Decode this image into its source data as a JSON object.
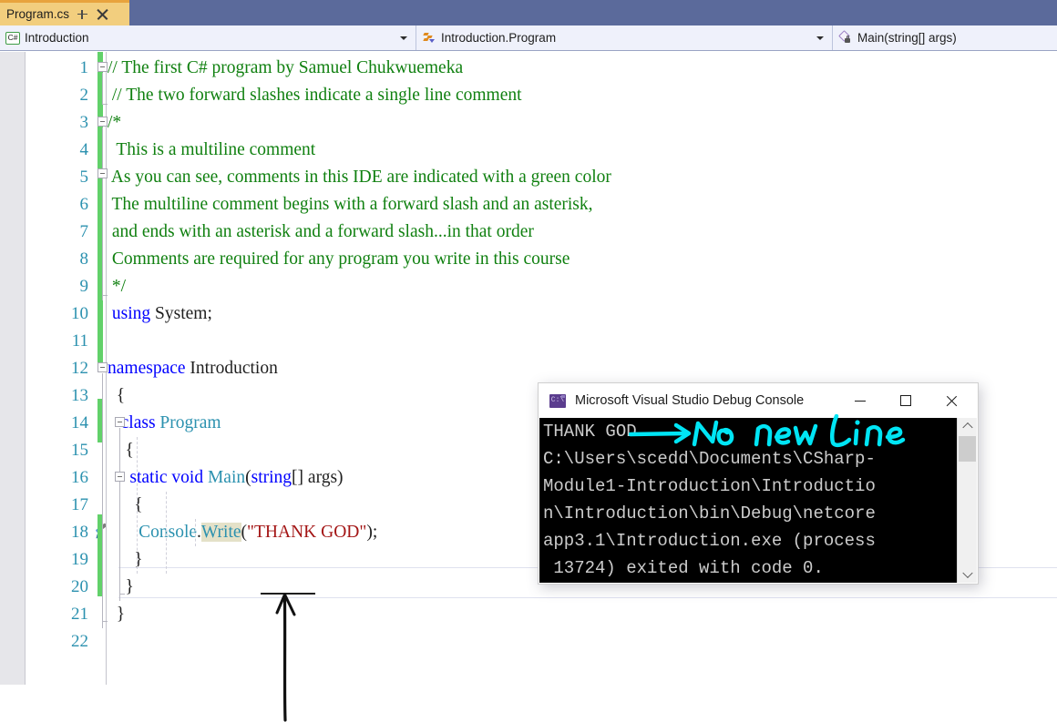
{
  "window": {
    "tab": {
      "label": "Program.cs",
      "pin_icon": "pin-icon",
      "close_icon": "close-icon"
    }
  },
  "navbar": {
    "project": {
      "icon": "csharp-file-icon",
      "text": "Introduction"
    },
    "class": {
      "icon": "class-lightning-icon",
      "text": "Introduction.Program"
    },
    "member": {
      "icon": "method-lock-icon",
      "text": "Main(string[] args)"
    }
  },
  "editor": {
    "line_numbers": [
      1,
      2,
      3,
      4,
      5,
      6,
      7,
      8,
      9,
      10,
      11,
      12,
      13,
      14,
      15,
      16,
      17,
      18,
      19,
      20,
      21,
      22
    ],
    "lines": [
      {
        "n": 1,
        "segments": [
          {
            "t": "// The first C# program by Samuel Chukwuemeka",
            "c": "cmt"
          }
        ]
      },
      {
        "n": 2,
        "segments": [
          {
            "t": " // The two forward slashes indicate a single line comment",
            "c": "cmt"
          }
        ]
      },
      {
        "n": 3,
        "segments": [
          {
            "t": "/*",
            "c": "cmt"
          }
        ]
      },
      {
        "n": 4,
        "segments": [
          {
            "t": "  This is a multiline comment",
            "c": "cmt"
          }
        ]
      },
      {
        "n": 5,
        "segments": [
          {
            "t": " As you can see, comments in this IDE are indicated with a green color",
            "c": "cmt"
          }
        ]
      },
      {
        "n": 6,
        "segments": [
          {
            "t": " The multiline comment begins with a forward slash and an asterisk,",
            "c": "cmt"
          }
        ]
      },
      {
        "n": 7,
        "segments": [
          {
            "t": " and ends with an asterisk and a forward slash...in that order",
            "c": "cmt"
          }
        ]
      },
      {
        "n": 8,
        "segments": [
          {
            "t": " Comments are required for any program you write in this course",
            "c": "cmt"
          }
        ]
      },
      {
        "n": 9,
        "segments": [
          {
            "t": " */",
            "c": "cmt"
          }
        ]
      },
      {
        "n": 10,
        "segments": [
          {
            "t": " using",
            "c": "kw"
          },
          {
            "t": " System;",
            "c": "pln"
          }
        ]
      },
      {
        "n": 11,
        "segments": []
      },
      {
        "n": 12,
        "segments": [
          {
            "t": "namespace",
            "c": "kw"
          },
          {
            "t": " Introduction",
            "c": "pln"
          }
        ]
      },
      {
        "n": 13,
        "segments": [
          {
            "t": "  {",
            "c": "pln"
          }
        ]
      },
      {
        "n": 14,
        "segments": [
          {
            "t": "   class",
            "c": "kw"
          },
          {
            "t": " ",
            "c": "pln"
          },
          {
            "t": "Program",
            "c": "typ"
          }
        ]
      },
      {
        "n": 15,
        "segments": [
          {
            "t": "    {",
            "c": "pln"
          }
        ]
      },
      {
        "n": 16,
        "segments": [
          {
            "t": "     static void",
            "c": "kw"
          },
          {
            "t": " ",
            "c": "pln"
          },
          {
            "t": "Main",
            "c": "typ"
          },
          {
            "t": "(",
            "c": "pln"
          },
          {
            "t": "string",
            "c": "kw"
          },
          {
            "t": "[] args)",
            "c": "pln"
          }
        ]
      },
      {
        "n": 17,
        "segments": [
          {
            "t": "      {",
            "c": "pln"
          }
        ]
      },
      {
        "n": 18,
        "segments": [
          {
            "t": "       Console",
            "c": "typ"
          },
          {
            "t": ".",
            "c": "pln"
          },
          {
            "t": "Write",
            "c": "typ",
            "hl": true
          },
          {
            "t": "(",
            "c": "pln"
          },
          {
            "t": "\"THANK GOD\"",
            "c": "str"
          },
          {
            "t": ");",
            "c": "pln"
          }
        ]
      },
      {
        "n": 19,
        "segments": [
          {
            "t": "      }",
            "c": "pln"
          }
        ]
      },
      {
        "n": 20,
        "segments": [
          {
            "t": "    }",
            "c": "pln"
          }
        ]
      },
      {
        "n": 21,
        "segments": [
          {
            "t": "  }",
            "c": "pln"
          }
        ]
      },
      {
        "n": 22,
        "segments": []
      }
    ],
    "current_line": 18,
    "modified_line_marker_icon": "pencil-icon"
  },
  "console": {
    "title": "Microsoft Visual Studio Debug Console",
    "app_icon": "console-app-icon",
    "buttons": {
      "minimize": "minimize-icon",
      "maximize": "maximize-icon",
      "close": "close-icon"
    },
    "output_lines": [
      "THANK GOD",
      "C:\\Users\\scedd\\Documents\\CSharp-",
      "Module1-Introduction\\Introductio",
      "n\\Introduction\\bin\\Debug\\netcore",
      "app3.1\\Introduction.exe (process",
      " 13724) exited with code 0."
    ],
    "scrollbar": {
      "up_icon": "chevron-up-icon",
      "down_icon": "chevron-down-icon"
    }
  },
  "annotations": {
    "ink_note": "No new line",
    "ink_color": "#00e5f5",
    "arrow_note": "arrow pointing at Console.Write"
  },
  "colors": {
    "tab_active": "#f2ce7e",
    "tab_accent": "#e8a33d",
    "tabstrip_bg": "#5b6a9b",
    "navbar_bg": "#eff1fb",
    "comment_green": "#108010",
    "keyword_blue": "#0000ff",
    "type_teal": "#2b91af",
    "string_red": "#a31515",
    "linenumber_blue": "#2b91af",
    "changebar_green": "#62d16a",
    "console_bg": "#000000",
    "console_fg": "#cccccc"
  }
}
